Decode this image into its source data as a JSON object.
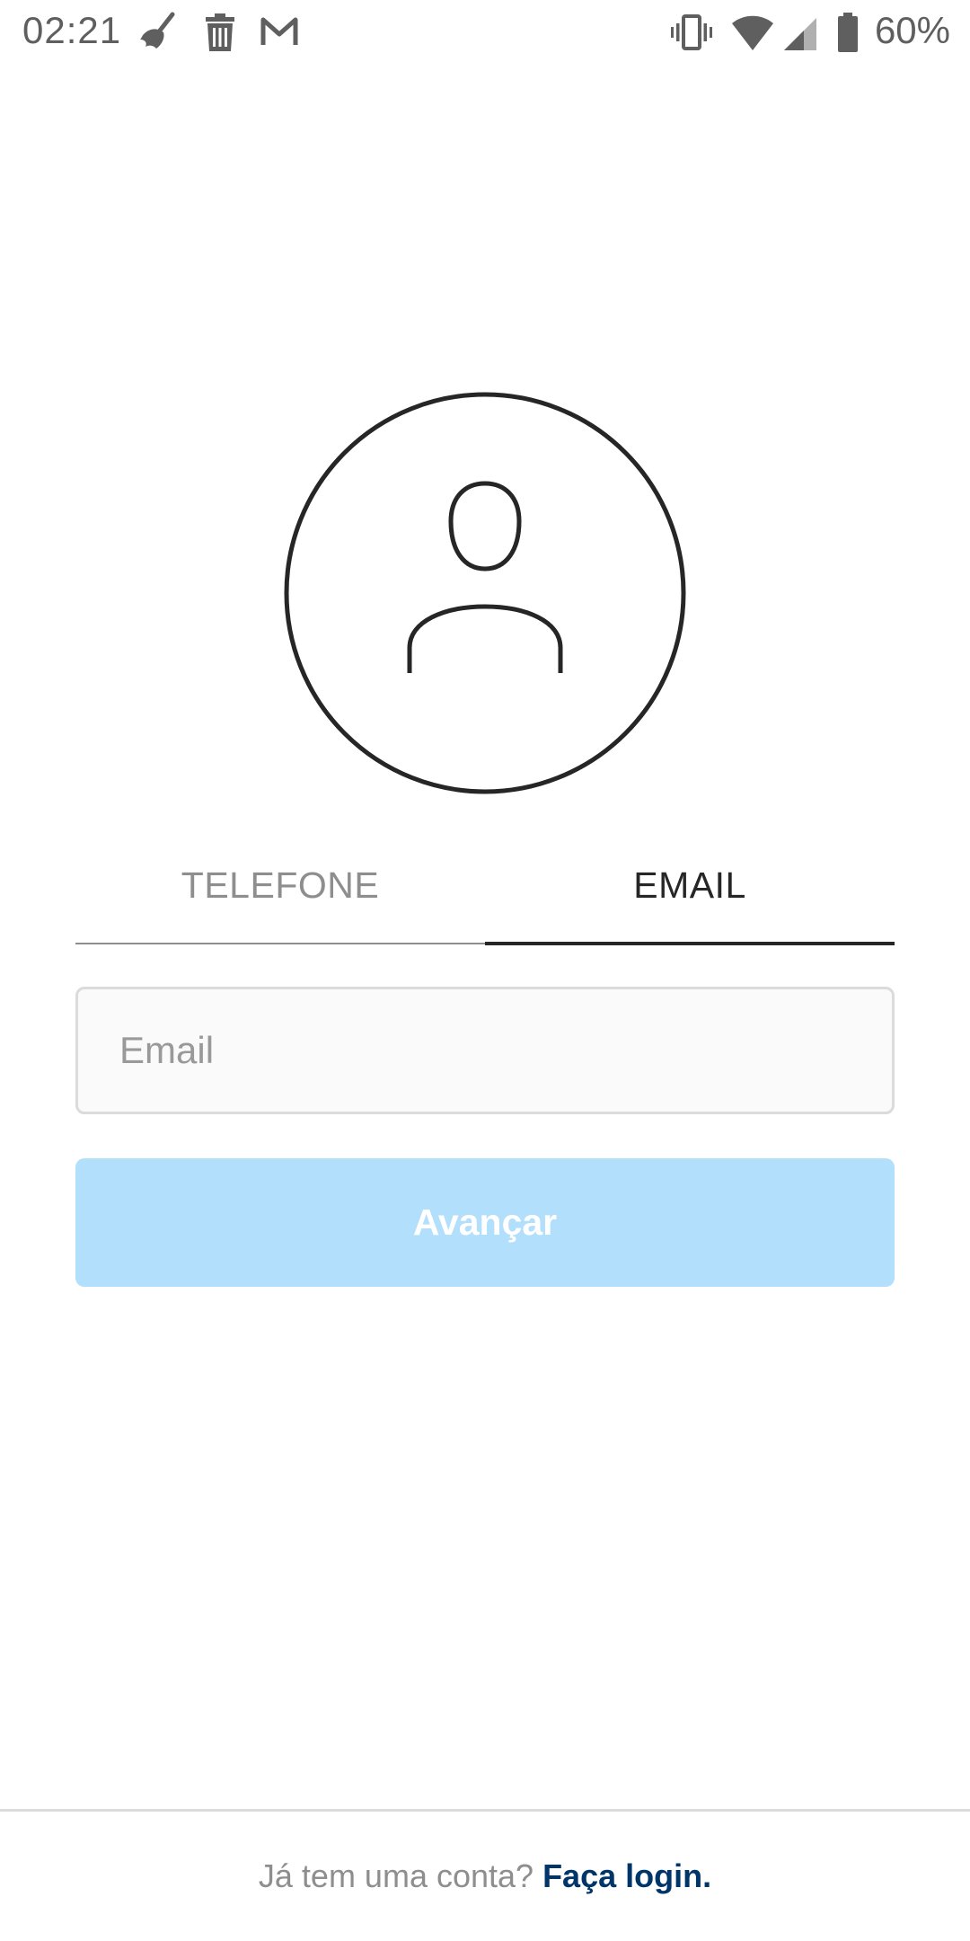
{
  "status_bar": {
    "time": "02:21",
    "battery_percent": "60%",
    "icons": [
      "broom-icon",
      "trash-icon",
      "gmail-icon",
      "vibrate-icon",
      "wifi-icon",
      "signal-icon",
      "battery-icon"
    ]
  },
  "avatar": {
    "icon": "user-profile-icon"
  },
  "tabs": {
    "phone_label": "TELEFONE",
    "email_label": "EMAIL",
    "active": "email"
  },
  "form": {
    "email_placeholder": "Email",
    "email_value": "",
    "next_label": "Avançar"
  },
  "footer": {
    "prompt": "Já tem uma conta?",
    "login_link": "Faça login."
  },
  "colors": {
    "button_disabled": "#b2dffc",
    "link": "#003569",
    "active_tab": "#262626",
    "inactive_tab": "#8e8e8e"
  }
}
